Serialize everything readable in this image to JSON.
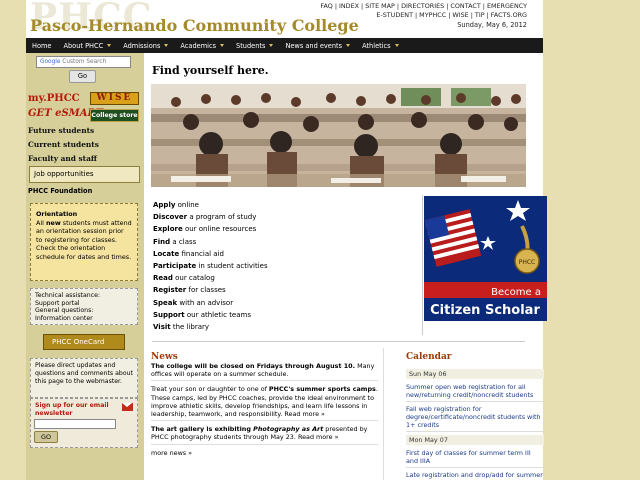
{
  "header": {
    "bg_letters": "PHCC",
    "college_name": "Pasco-Hernando Community College",
    "utility_links": "FAQ | INDEX | SITE MAP | DIRECTORIES | CONTACT | EMERGENCY",
    "utility_links2": "E-STUDENT | MYPHCC | WISE | TIP | FACTS.ORG",
    "date": "Sunday, May 6, 2012"
  },
  "nav": [
    "Home",
    "About PHCC",
    "Admissions",
    "Academics",
    "Students",
    "News and events",
    "Athletics"
  ],
  "sidebar": {
    "search_brand": "Google",
    "search_placeholder": "Custom Search",
    "go": "Go",
    "myphcc": "my.PHCC",
    "wise": "WISE",
    "getsmart": "GET eSMART",
    "estore": "College store",
    "links": [
      "Future students",
      "Current students",
      "Faculty and staff"
    ],
    "job": "Job opportunities",
    "foundation": "PHCC Foundation",
    "orientation_title": "Orientation",
    "orientation_text1": "All ",
    "orientation_new": "new",
    "orientation_text2": " students must attend an orientation session prior to registering for classes. Check the orientation schedule for dates and times.",
    "tech": [
      "Technical assistance:",
      "Support portal",
      "General questions:",
      "Information center"
    ],
    "onecard_prefix": "PHCC",
    "onecard": "OneCard",
    "updates": "Please direct updates and questions and comments about this page to the webmaster.",
    "signup": "Sign up for our email newsletter",
    "signup_go": "GO"
  },
  "main": {
    "headline": "Find yourself here.",
    "actions": [
      {
        "verb": "Apply",
        "rest": " online"
      },
      {
        "verb": "Discover",
        "rest": " a program of study"
      },
      {
        "verb": "Explore",
        "rest": " our online resources"
      },
      {
        "verb": "Find",
        "rest": " a class"
      },
      {
        "verb": "Locate",
        "rest": " financial aid"
      },
      {
        "verb": "Participate",
        "rest": " in student activities"
      },
      {
        "verb": "Read",
        "rest": " our catalog"
      },
      {
        "verb": "Register",
        "rest": " for classes"
      },
      {
        "verb": "Speak",
        "rest": " with an advisor"
      },
      {
        "verb": "Support",
        "rest": " our athletic teams"
      },
      {
        "verb": "Visit",
        "rest": " the library"
      }
    ],
    "citizen_line1": "Become a",
    "citizen_line2": "Citizen Scholar",
    "citizen_seal": "PHCC"
  },
  "news": {
    "title": "News",
    "item1_bold": "The college will be closed on Fridays through August 10.",
    "item1_rest": " Many offices will operate on a summer schedule.",
    "item2_pre": "Treat your son or daughter to one of ",
    "item2_bold": "PHCC's summer sports camps",
    "item2_rest": ". These camps, led by PHCC coaches, provide the ideal environment to improve athletic skills, develop friendships, and learn life lessons in leadership, teamwork, and responsibility. Read more »",
    "item3_bold": "The art gallery is exhibiting ",
    "item3_ital": "Photography as Art",
    "item3_rest": " presented by PHCC photography students through May 23. Read more »",
    "more": "more news »"
  },
  "calendar": {
    "title": "Calendar",
    "days": [
      {
        "date": "Sun May 06",
        "events": [
          "Summer open web registration for all new/returning credit/noncredit students",
          "Fall web registration for degree/certificate/noncredit students with 1+ credits"
        ]
      },
      {
        "date": "Mon May 07",
        "events": [
          "First day of classes for summer term III and IIIA",
          "Late registration and drop/add for summer term III and IIIA classes begins"
        ]
      }
    ]
  }
}
